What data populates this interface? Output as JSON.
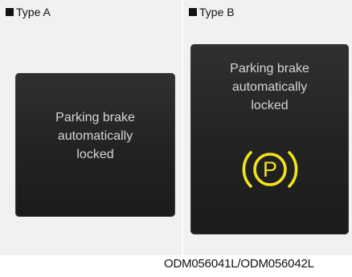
{
  "panels": [
    {
      "label": "Type A",
      "message": [
        "Parking brake",
        "automatically",
        "locked"
      ]
    },
    {
      "label": "Type B",
      "message": [
        "Parking brake",
        "automatically",
        "locked"
      ],
      "icon": "parking-brake-icon",
      "icon_letter": "P",
      "icon_color": "#f2e31a"
    }
  ],
  "caption": "ODM056041L/ODM056042L"
}
